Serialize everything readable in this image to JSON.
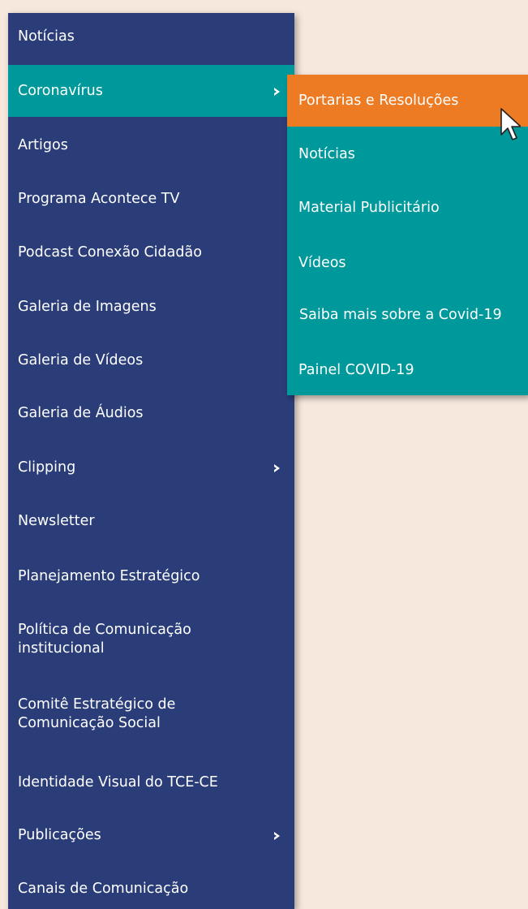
{
  "colors": {
    "page_background": "#f6e8dd",
    "menu_background": "#2b3d78",
    "active_teal": "#00999b",
    "submenu_background": "#00999b",
    "hover_orange": "#ec7b24",
    "text": "#ffffff"
  },
  "main_menu": {
    "items": [
      {
        "label": "Notícias",
        "has_submenu": false
      },
      {
        "label": "Coronavírus",
        "has_submenu": true,
        "active": true
      },
      {
        "label": "Artigos",
        "has_submenu": false
      },
      {
        "label": "Programa Acontece TV",
        "has_submenu": false
      },
      {
        "label": "Podcast Conexão Cidadão",
        "has_submenu": false
      },
      {
        "label": "Galeria de Imagens",
        "has_submenu": false
      },
      {
        "label": "Galeria de Vídeos",
        "has_submenu": false
      },
      {
        "label": "Galeria de Áudios",
        "has_submenu": false
      },
      {
        "label": "Clipping",
        "has_submenu": true
      },
      {
        "label": "Newsletter",
        "has_submenu": false
      },
      {
        "label": "Planejamento Estratégico",
        "has_submenu": false
      },
      {
        "label": "Política de Comunicação\ninstitucional",
        "has_submenu": false
      },
      {
        "label": "Comitê Estratégico de\nComunicação Social",
        "has_submenu": false
      },
      {
        "label": "Identidade Visual do TCE-CE",
        "has_submenu": false
      },
      {
        "label": "Publicações",
        "has_submenu": true
      },
      {
        "label": "Canais de Comunicação",
        "has_submenu": false
      }
    ]
  },
  "submenu": {
    "parent": "Coronavírus",
    "items": [
      {
        "label": "Portarias e Resoluções",
        "hovered": true
      },
      {
        "label": "Notícias"
      },
      {
        "label": "Material Publicitário"
      },
      {
        "label": "Vídeos"
      },
      {
        "label": "Saiba mais sobre a Covid-19"
      },
      {
        "label": "Painel COVID-19"
      }
    ]
  },
  "icons": {
    "chevron": "chevron-right-icon",
    "cursor": "mouse-pointer-icon"
  }
}
